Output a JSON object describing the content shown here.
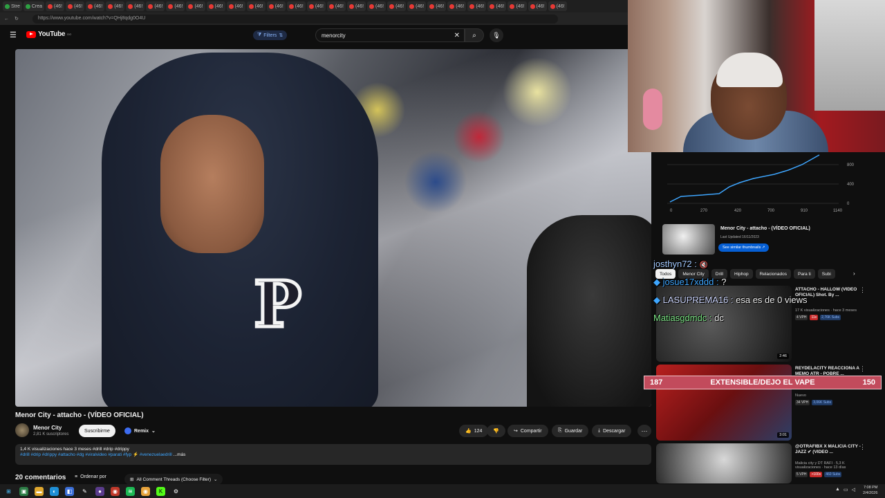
{
  "browser": {
    "tabs": [
      "Stre",
      "Crea",
      "(46!",
      "(46!",
      "(46!",
      "(46!",
      "(46!",
      "(46!",
      "(46!",
      "(46!",
      "(46!",
      "(46!",
      "(46!",
      "(46!",
      "(46!",
      "(46!",
      "(46!",
      "(46!",
      "(46!",
      "(46!",
      "(46!",
      "(46!",
      "(46!",
      "(46!",
      "(46!",
      "(46!",
      "(46!",
      "(46!"
    ],
    "url": "https://www.youtube.com/watch?v=QHj8qdg0O4U"
  },
  "header": {
    "logo": "YouTube",
    "logo_region": "DO",
    "filters_label": "Filters",
    "search_value": "menorcity"
  },
  "video": {
    "title": "Menor City - attacho - (VÍDEO OFICIAL)",
    "channel": "Menor City",
    "subscribers": "2,81 K suscriptores",
    "subscribe_label": "Suscribirme",
    "remix_label": "Remix",
    "likes": "124",
    "share_label": "Compartir",
    "save_label": "Guardar",
    "download_label": "Descargar"
  },
  "description": {
    "stats": "1,4 K visualizaciones  hace 3 meses  #drill #drip #drippy",
    "tags": "#drill #drip #drippy #attacho #dg #viralvideo #parati #fyp ⚡ #venezuelaedrill",
    "more": "...más"
  },
  "comments": {
    "count_label": "20 comentarios",
    "sort_label": "Ordenar por",
    "thread_filter": "All Comment Threads (Choose Filter)"
  },
  "stats_chart": {
    "x_ticks": [
      "0",
      "270",
      "420",
      "700",
      "910",
      "1140"
    ],
    "y_ticks": [
      "0",
      "400",
      "800"
    ]
  },
  "related_card": {
    "title": "Menor City - attacho - (VÍDEO OFICIAL)",
    "updated": "Last Updated 16/11/2023",
    "button": "See similar thumbnails ↗"
  },
  "chips": [
    "Todos",
    "Menor City",
    "Drill",
    "Hiphop",
    "Relacionados",
    "Para ti",
    "Subi"
  ],
  "recommendations": [
    {
      "title": "ATTACHO - HALLOW (VIDEO OFICIAL) Shot. By ...",
      "meta": "17 K visualizaciones · hace 3 meses",
      "badges": [
        "4 VPH",
        "11x",
        "2,76K Subs"
      ],
      "duration": "2:46"
    },
    {
      "title": "REYDELACITY REACCIONA A MEMO ATR - POBRE ...",
      "meta": "Nuevo",
      "badges": [
        "34 VPH",
        "3,06K Subs"
      ],
      "duration": "3:01"
    },
    {
      "title": "@OTRAFIBX X MALICIA CITY - JAZZ ✔ (VIDEO ...",
      "meta": "Malicia city y DT RAFI · 5,3 K visualizaciones · hace 13 días",
      "badges": [
        "5 VPH",
        ">100x",
        "460 Subs"
      ],
      "duration": ""
    }
  ],
  "overlay": {
    "chat": [
      {
        "user": "josthyn72 :",
        "msg": ""
      },
      {
        "user": "josue17xddd :",
        "msg": "?"
      },
      {
        "user": "LASUPREMA16 :",
        "msg": "esa es de 0 views"
      },
      {
        "user": "Matiasgdmdc :",
        "msg": "dc"
      }
    ],
    "goal_left": "187",
    "goal_text": "EXTENSIBLE/DEJO EL VAPE",
    "goal_right": "150"
  },
  "taskbar": {
    "time": "7:08 PM",
    "date": "2/4/2026"
  }
}
